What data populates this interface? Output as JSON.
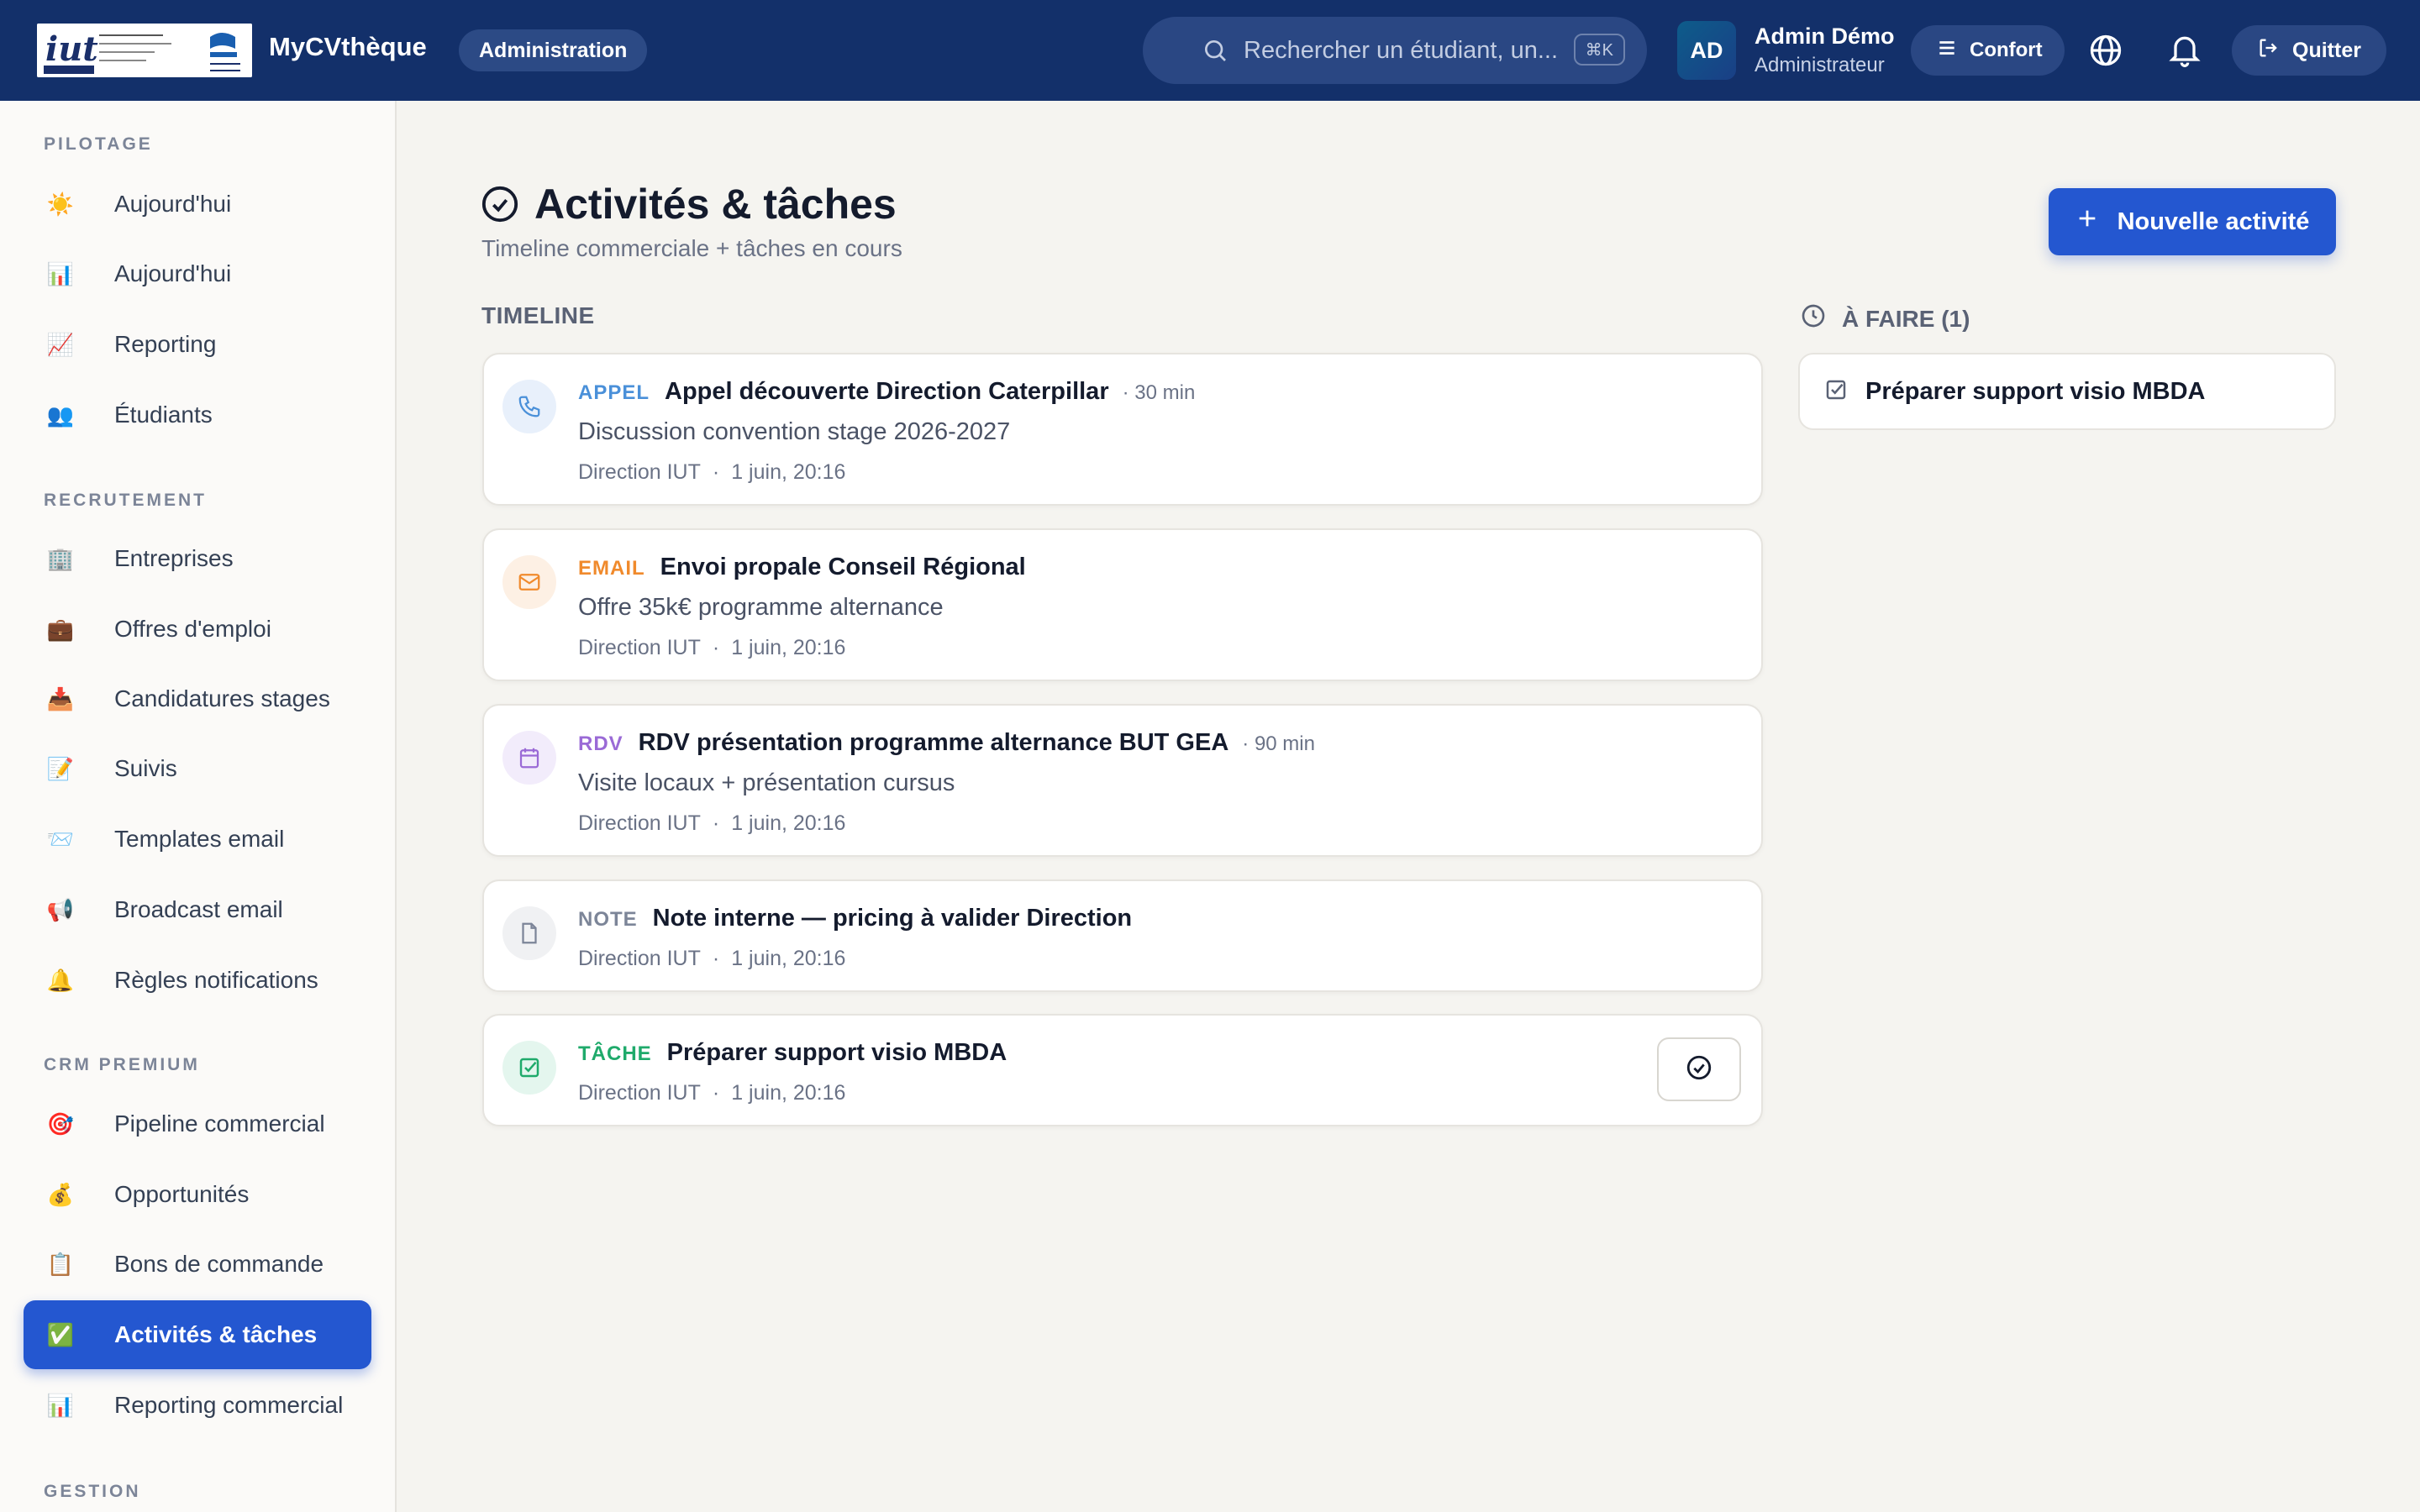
{
  "header": {
    "brand": "MyCVthèque",
    "admin_pill": "Administration",
    "search_placeholder": "Rechercher un étudiant, un...",
    "search_shortcut": "⌘K",
    "user_initials": "AD",
    "user_name": "Admin Démo",
    "user_role": "Administrateur",
    "confort_label": "Confort",
    "quit_label": "Quitter"
  },
  "sidebar": {
    "sections": [
      {
        "title": "PILOTAGE",
        "items": [
          {
            "icon": "☀️",
            "label": "Aujourd'hui"
          },
          {
            "icon": "📊",
            "label": "Aujourd'hui"
          },
          {
            "icon": "📈",
            "label": "Reporting"
          },
          {
            "icon": "👥",
            "label": "Étudiants"
          }
        ]
      },
      {
        "title": "RECRUTEMENT",
        "items": [
          {
            "icon": "🏢",
            "label": "Entreprises"
          },
          {
            "icon": "💼",
            "label": "Offres d'emploi"
          },
          {
            "icon": "📥",
            "label": "Candidatures stages"
          },
          {
            "icon": "📝",
            "label": "Suivis"
          },
          {
            "icon": "📨",
            "label": "Templates email"
          },
          {
            "icon": "📢",
            "label": "Broadcast email"
          },
          {
            "icon": "🔔",
            "label": "Règles notifications"
          }
        ]
      },
      {
        "title": "CRM PREMIUM",
        "items": [
          {
            "icon": "🎯",
            "label": "Pipeline commercial"
          },
          {
            "icon": "💰",
            "label": "Opportunités"
          },
          {
            "icon": "📋",
            "label": "Bons de commande"
          },
          {
            "icon": "✅",
            "label": "Activités & tâches",
            "active": true
          },
          {
            "icon": "📊",
            "label": "Reporting commercial"
          }
        ]
      },
      {
        "title": "GESTION",
        "items": []
      }
    ]
  },
  "main": {
    "title": "Activités & tâches",
    "subtitle": "Timeline commerciale + tâches en cours",
    "new_button": "Nouvelle activité",
    "timeline_heading": "TIMELINE",
    "todo_heading": "À FAIRE (1)",
    "activities": [
      {
        "type": "APPEL",
        "title": "Appel découverte Direction Caterpillar",
        "duration": "· 30 min",
        "description": "Discussion convention stage 2026-2027",
        "author": "Direction IUT",
        "date": "1 juin, 20:16",
        "color": "#4a90d9",
        "bg": "#e8f0fb"
      },
      {
        "type": "EMAIL",
        "title": "Envoi propale Conseil Régional",
        "duration": "",
        "description": "Offre 35k€ programme alternance",
        "author": "Direction IUT",
        "date": "1 juin, 20:16",
        "color": "#f08a2c",
        "bg": "#fdf0e4"
      },
      {
        "type": "RDV",
        "title": "RDV présentation programme alternance BUT GEA",
        "duration": "· 90 min",
        "description": "Visite locaux + présentation cursus",
        "author": "Direction IUT",
        "date": "1 juin, 20:16",
        "color": "#9a6ad6",
        "bg": "#f2ecfb"
      },
      {
        "type": "NOTE",
        "title": "Note interne — pricing à valider Direction",
        "duration": "",
        "description": "",
        "author": "Direction IUT",
        "date": "1 juin, 20:16",
        "color": "#7c8598",
        "bg": "#f0f1f3"
      },
      {
        "type": "TÂCHE",
        "title": "Préparer support visio MBDA",
        "duration": "",
        "description": "",
        "author": "Direction IUT",
        "date": "1 juin, 20:16",
        "color": "#1faa6b",
        "bg": "#e4f6ee"
      }
    ],
    "todos": [
      {
        "title": "Préparer support visio MBDA"
      }
    ],
    "meta_separator": "·"
  }
}
